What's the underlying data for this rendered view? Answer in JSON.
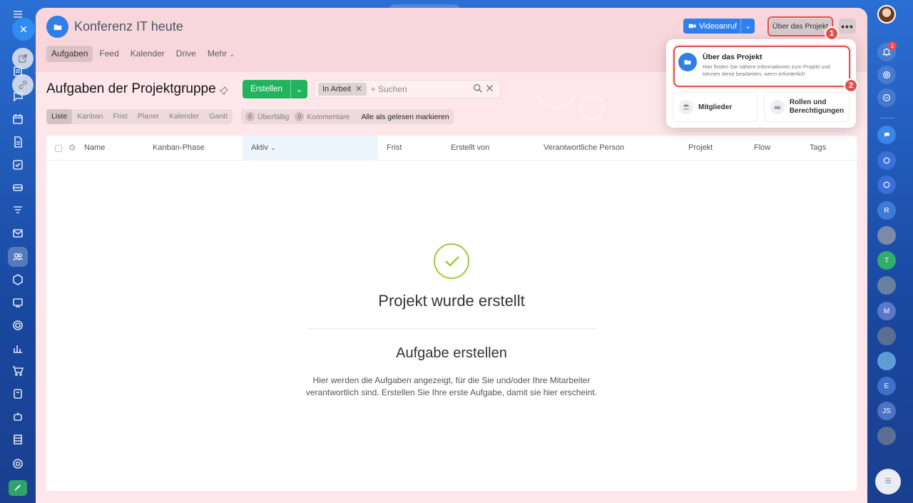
{
  "project": {
    "title": "Konferenz IT heute"
  },
  "nav_tabs": [
    {
      "label": "Aufgaben"
    },
    {
      "label": "Feed"
    },
    {
      "label": "Kalender"
    },
    {
      "label": "Drive"
    },
    {
      "label": "Mehr"
    }
  ],
  "header_buttons": {
    "video_call": "Videoanruf",
    "about_project": "Über das Projekt",
    "more": "•••"
  },
  "step_badges": [
    "1",
    "2"
  ],
  "page": {
    "title": "Aufgaben der Projektgruppe"
  },
  "toolbar": {
    "create_label": "Erstellen",
    "filter_chip": "In Arbeit",
    "search_placeholder": "+ Suchen"
  },
  "view_switch": [
    "Liste",
    "Kanban",
    "Frist",
    "Planer",
    "Kalender",
    "Gantt"
  ],
  "counters": {
    "overdue_count": "0",
    "overdue_label": "Überfällig",
    "comments_count": "0",
    "comments_label": "Kommentare",
    "mark_read": "Alle als gelesen markieren"
  },
  "table": {
    "columns": [
      "Name",
      "Kanban-Phase",
      "Aktiv",
      "Frist",
      "Erstellt von",
      "Verantwortliche Person",
      "Projekt",
      "Flow",
      "Tags"
    ]
  },
  "empty_state": {
    "title": "Projekt wurde erstellt",
    "subtitle": "Aufgabe erstellen",
    "description": "Hier werden die Aufgaben angezeigt, für die Sie und/oder Ihre Mitarbeiter verantwortlich sind. Erstellen Sie Ihre erste Aufgabe, damit sie hier erscheint."
  },
  "popup": {
    "about_title": "Über das Projekt",
    "about_desc": "Hier finden Sie nähere Informationen zum Projekt und können diese bearbeiten, wenn erforderlich",
    "members": "Mitglieder",
    "roles": "Rollen und Berechtigungen"
  },
  "notifications": {
    "badge": "1"
  },
  "right_rail_avatars": [
    "R",
    "T",
    "M",
    "E",
    "JS"
  ],
  "colors": {
    "accent_blue": "#2f80ed",
    "create_green": "#23b35d",
    "highlight_red": "#e0504e",
    "panel_pink": "#fde7ea"
  }
}
